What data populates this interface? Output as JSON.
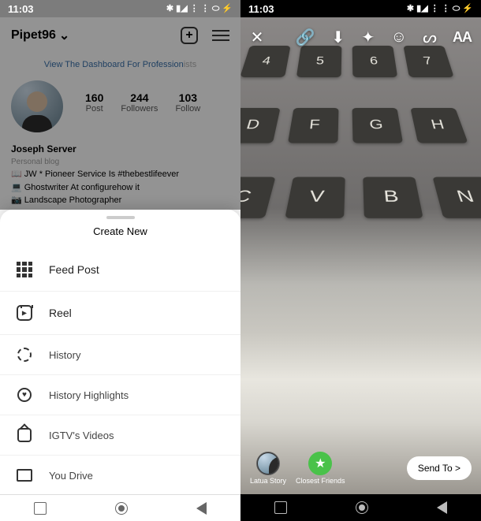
{
  "status": {
    "time": "11:03",
    "icons": "✱ ▮◢ ⋮ ⋮ ⬭ ⚡"
  },
  "left": {
    "username": "Pipet96",
    "dashboard": {
      "text": "View The Dashboard For Profession",
      "suffix": "ists"
    },
    "stats": [
      {
        "num": "160",
        "label": "Post"
      },
      {
        "num": "244",
        "label": "Followers"
      },
      {
        "num": "103",
        "label": "Follow"
      }
    ],
    "bio": {
      "name": "Joseph Server",
      "category": "Personal blog",
      "line1": "📖 JW * Pioneer Service Is #thebestlifeever",
      "line2": "💻 Ghostwriter At configurehow it",
      "line3": "📷 Landscape Photographer"
    },
    "sheet": {
      "title": "Create New",
      "items": [
        {
          "label": "Feed Post"
        },
        {
          "label": "Reel"
        },
        {
          "label": "History"
        },
        {
          "label": "History Highlights"
        },
        {
          "label": "IGTV's Videos"
        },
        {
          "label": "You Drive"
        }
      ]
    }
  },
  "right": {
    "audiences": [
      {
        "label": "Latua Story"
      },
      {
        "label": "Closest Friends"
      }
    ],
    "send": "Send To >"
  }
}
